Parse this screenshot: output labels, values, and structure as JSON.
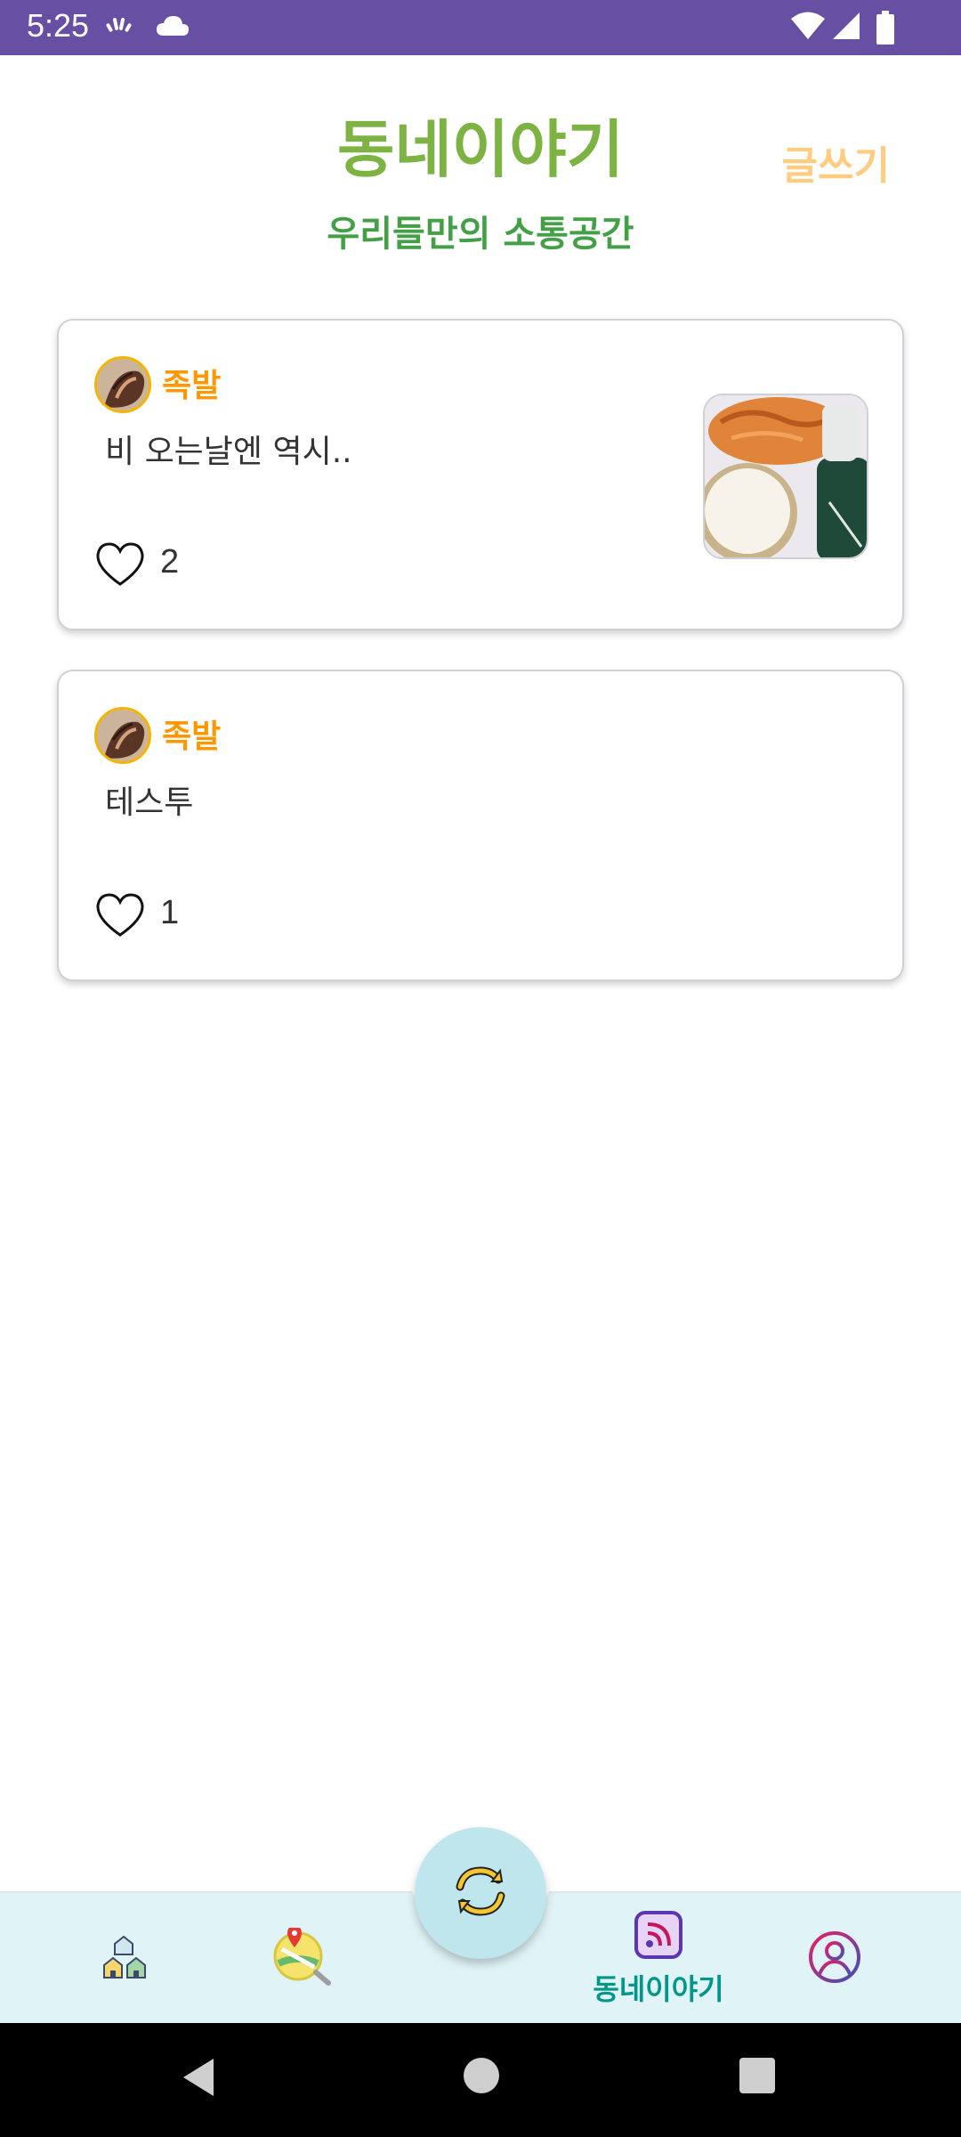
{
  "status_bar": {
    "time": "5:25",
    "icons": [
      "cellular-activity-icon",
      "cloud-icon",
      "wifi-icon",
      "signal-icon",
      "battery-icon"
    ]
  },
  "header": {
    "title": "동네이야기",
    "subtitle": "우리들만의 소통공간",
    "write_label": "글쓰기"
  },
  "posts": [
    {
      "author": "족발",
      "content": "비 오는날엔 역시..",
      "likes": "2",
      "has_image": true
    },
    {
      "author": "족발",
      "content": "테스투",
      "likes": "1",
      "has_image": false
    }
  ],
  "bottom_nav": {
    "items": [
      {
        "icon": "home-icon",
        "label": ""
      },
      {
        "icon": "map-search-icon",
        "label": ""
      },
      {
        "icon": "refresh-icon",
        "label": ""
      },
      {
        "icon": "feed-icon",
        "label": "동네이야기",
        "active": true
      },
      {
        "icon": "profile-icon",
        "label": ""
      }
    ]
  },
  "colors": {
    "status_bar": "#6750a4",
    "title": "#7cb342",
    "subtitle": "#43a047",
    "write": "#ffcc80",
    "author": "#ff9800",
    "nav_bg": "#e0f4f7",
    "nav_active": "#009688"
  }
}
